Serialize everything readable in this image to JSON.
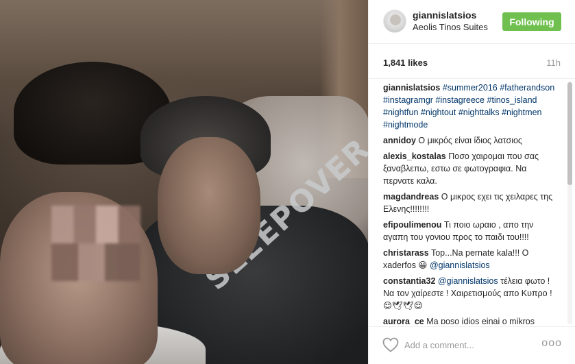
{
  "post": {
    "username": "giannislatsios",
    "location": "Aeolis Tinos Suites",
    "follow_label": "Following",
    "likes": "1,841 likes",
    "time": "11h",
    "shirt_text": "SLEEPOVER"
  },
  "caption": {
    "user": "giannislatsios",
    "tags": [
      "#summer2016",
      "#fatherandson",
      "#instagramgr",
      "#instagreece",
      "#tinos_island",
      "#nightfun",
      "#nightout",
      "#nighttalks",
      "#nightmen",
      "#nightmode"
    ]
  },
  "comments": [
    {
      "user": "annidoy",
      "text": "Ο μικρός είναι ίδιος λατσιος"
    },
    {
      "user": "alexis_kostalas",
      "text": "Ποσο χαιρομαι που σας ξαναβλεπω, εστω σε φωτογραφια. Να περνατε καλα."
    },
    {
      "user": "magdandreas",
      "text": "Ο μικρος εχει τις χειλαρες της Ελενης!!!!!!!!"
    },
    {
      "user": "efipoulimenou",
      "text": "Τι ποιο ωραιο , απο την αγαπη του γονιου προς το παιδι του!!!!"
    },
    {
      "user": "christarass",
      "text": "Top...Na pernate kala!!! O xaderfos 😀",
      "mention": "@giannislatsios"
    },
    {
      "user": "constantia32",
      "mention": "@giannislatsios",
      "text": "τέλεια φωτο ! Να τον χαίρεστε ! Χαιρετισμούς απο Κυπρο ! 😌🕊🕊😌"
    },
    {
      "user": "aurora_ce",
      "text": "Ma poso idios einai o mikros pante eutixizmeni 💞"
    }
  ],
  "add_comment": {
    "placeholder": "Add a comment...",
    "more": "ooo"
  }
}
